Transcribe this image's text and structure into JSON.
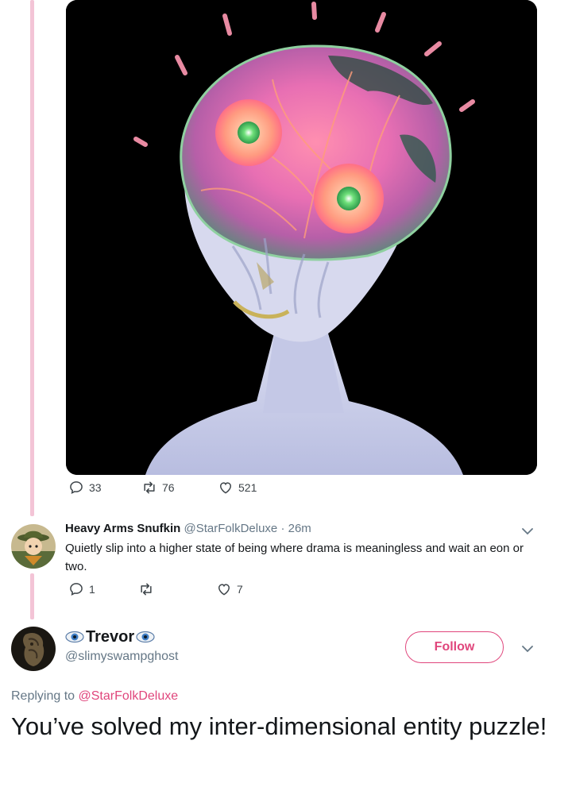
{
  "image": {
    "description": "Painting of a pale grey alien with a translucent brain-like head containing two glowing green-iris eyes on a black background"
  },
  "first_tweet": {
    "stats": {
      "replies": "33",
      "retweets": "76",
      "likes": "521"
    }
  },
  "reply_tweet": {
    "display_name": "Heavy Arms Snufkin",
    "handle": "@StarFolkDeluxe",
    "separator": "·",
    "time": "26m",
    "text": "Quietly slip into a higher state of being where drama is meaningless and wait an eon or two.",
    "stats": {
      "replies": "1",
      "retweets": "",
      "likes": "7"
    }
  },
  "focus_tweet": {
    "display_name": "Trevor",
    "handle": "@slimyswampghost",
    "follow_label": "Follow",
    "replying_prefix": "Replying to",
    "replying_to": "@StarFolkDeluxe",
    "text": "You’ve solved my inter-dimensional entity puzzle!"
  },
  "icons": [
    "reply-icon",
    "retweet-icon",
    "like-icon",
    "chevron-down-icon",
    "eye-emoji-icon"
  ],
  "colors": {
    "accent": "#e0467c",
    "thread_line": "#f3c4d6",
    "muted": "#657786"
  }
}
